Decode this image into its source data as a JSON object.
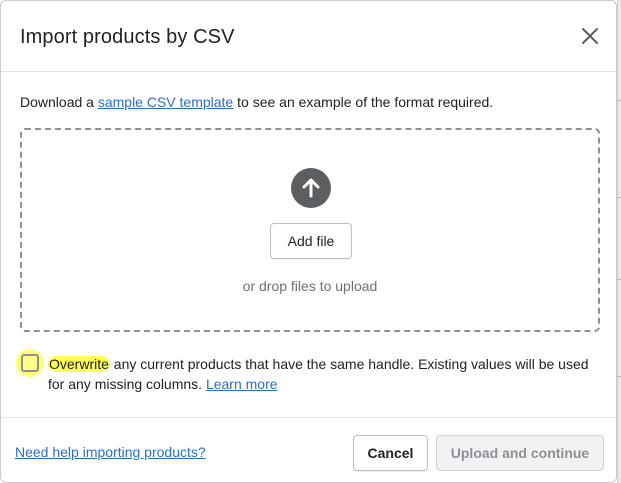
{
  "dialog": {
    "title": "Import products by CSV"
  },
  "download": {
    "prefix": "Download a ",
    "link_text": "sample CSV template",
    "suffix": " to see an example of the format required."
  },
  "dropzone": {
    "add_file_label": "Add file",
    "hint": "or drop files to upload"
  },
  "overwrite": {
    "checked": false,
    "highlight_word": "Overwrite",
    "text": " any current products that have the same handle. Existing values will be used for any missing columns. ",
    "learn_more": "Learn more"
  },
  "footer": {
    "help_link": "Need help importing products?",
    "cancel_label": "Cancel",
    "upload_label": "Upload and continue"
  },
  "colors": {
    "link": "#2c6ecb",
    "highlight": "#ffff55",
    "disabled_text": "#8c9196"
  }
}
